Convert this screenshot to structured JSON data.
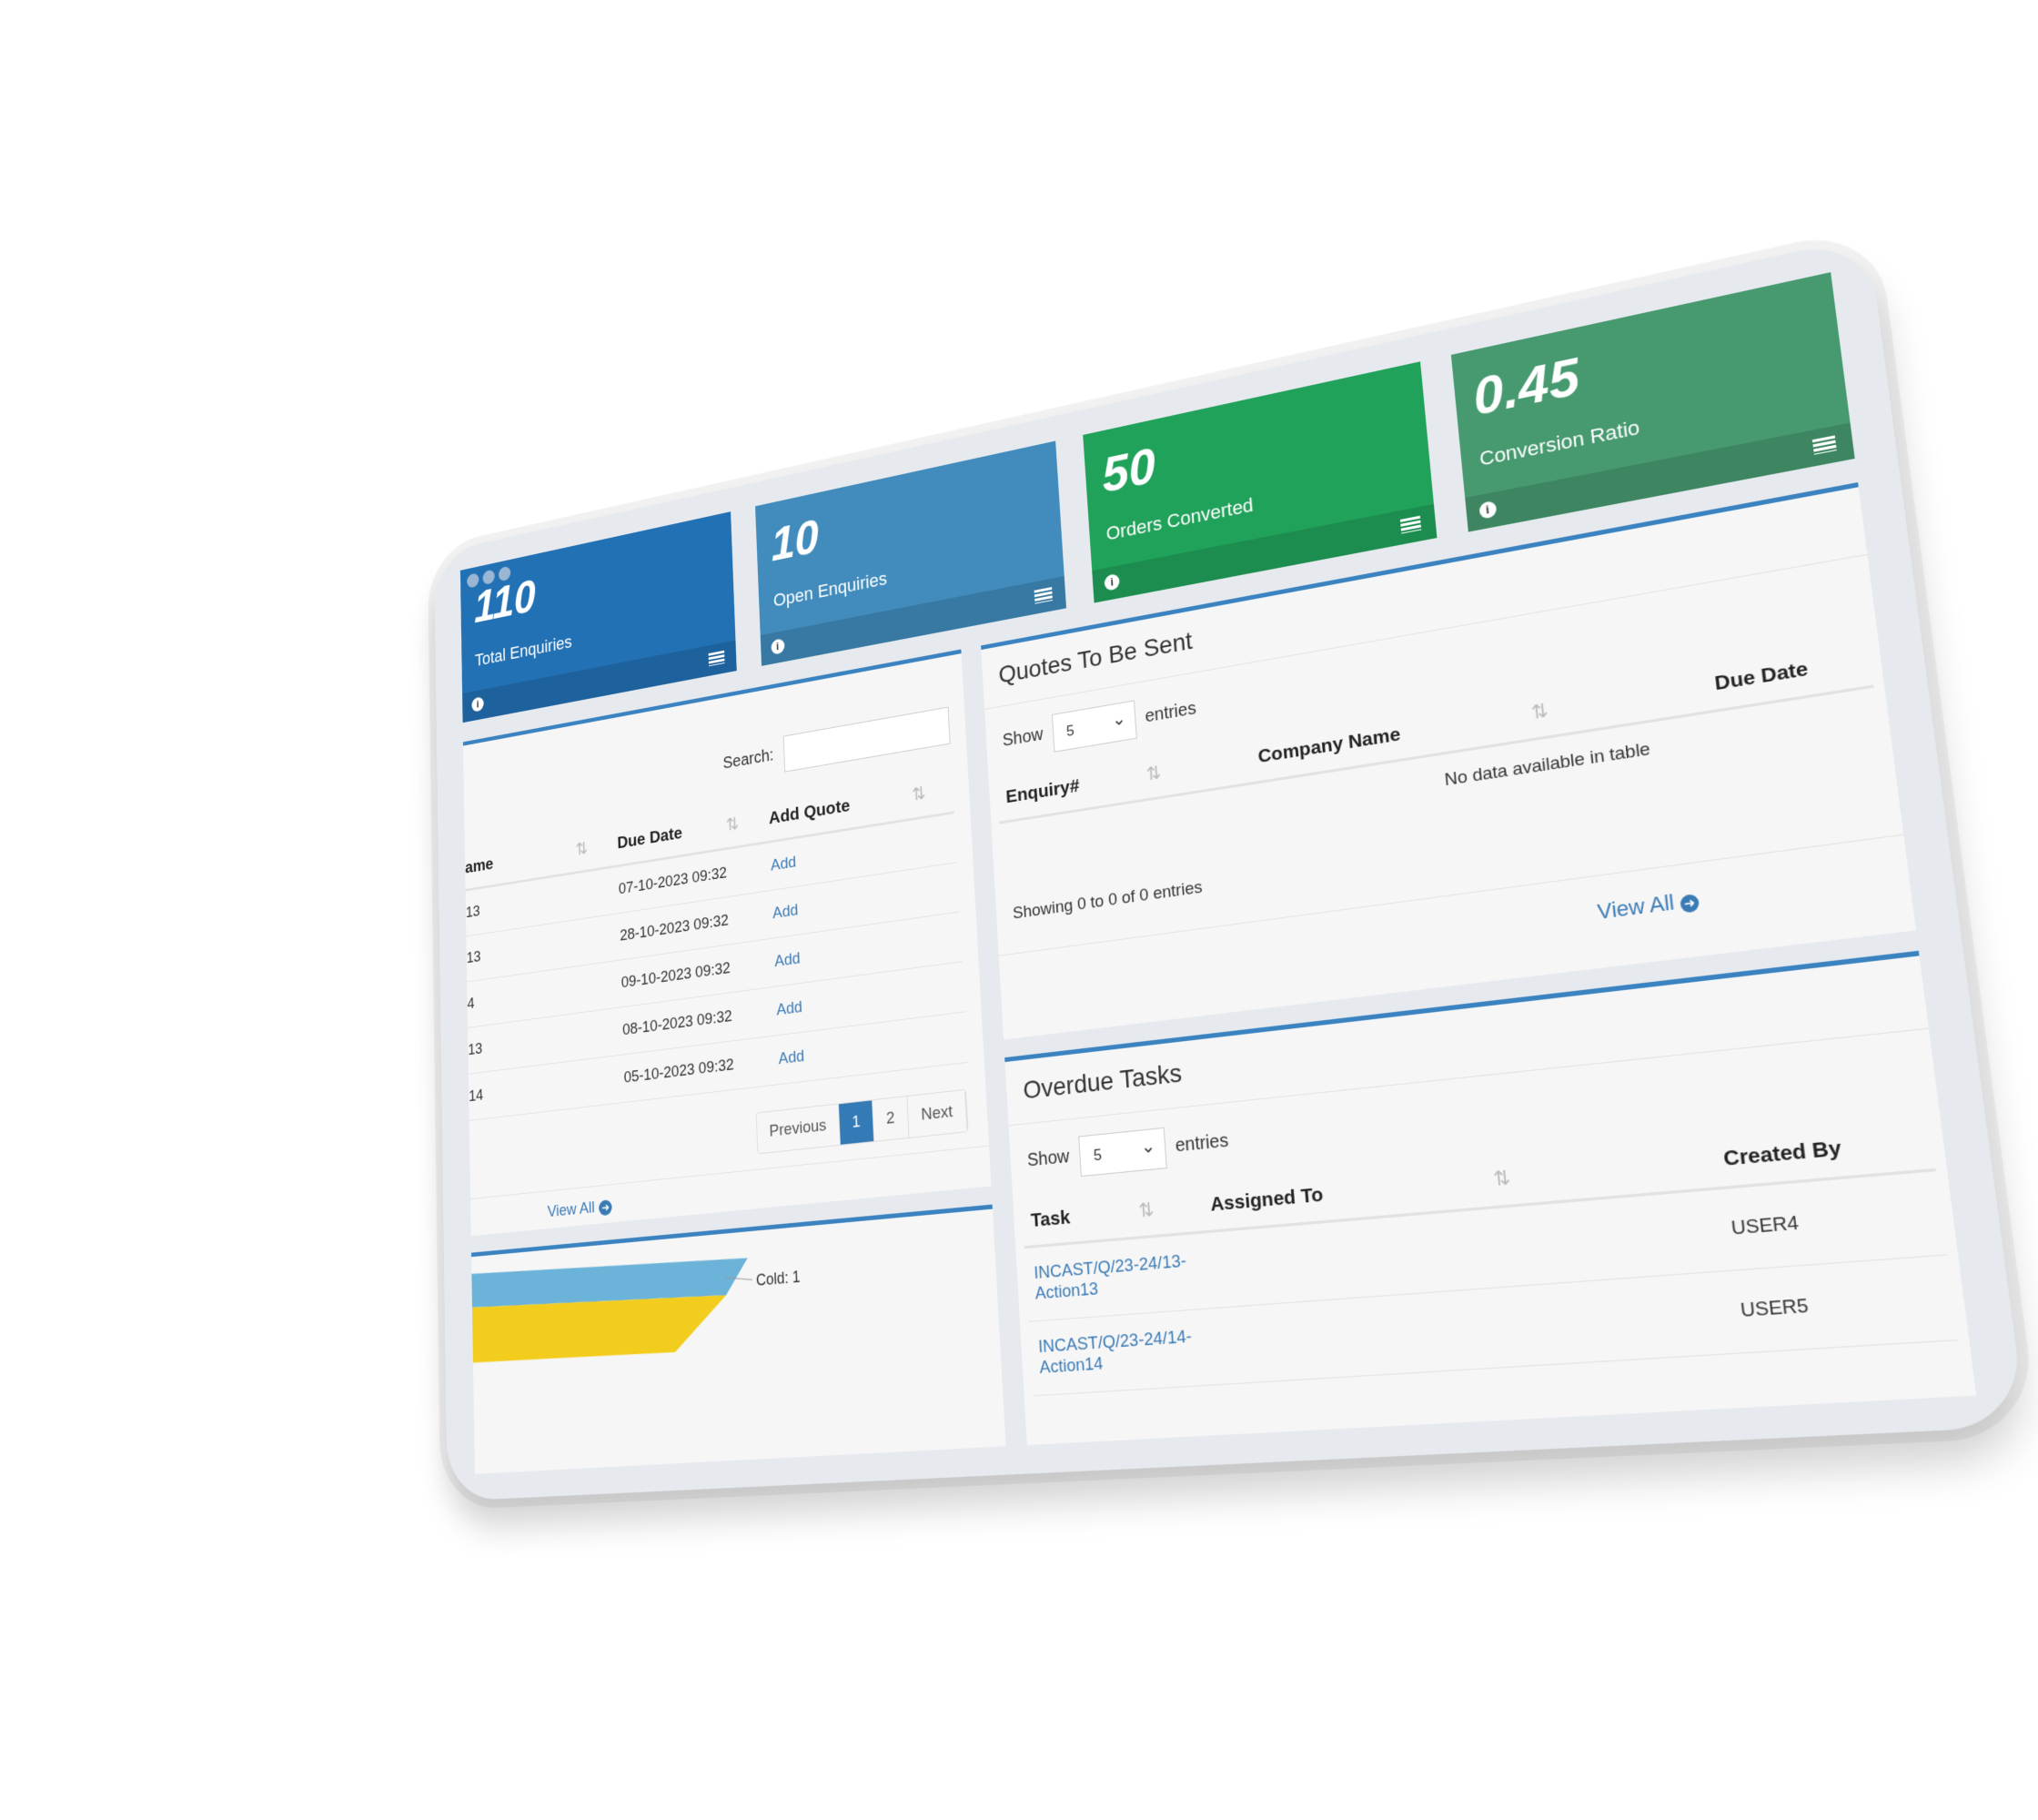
{
  "cards": [
    {
      "value": "110",
      "label": "Total Enquiries",
      "color": "#2371b5"
    },
    {
      "value": "10",
      "label": "Open Enquiries",
      "color": "#418cbc"
    },
    {
      "value": "50",
      "label": "Orders Converted",
      "color": "#21a25a"
    },
    {
      "value": "0.45",
      "label": "Conversion Ratio",
      "color": "#479a70"
    }
  ],
  "enquiries": {
    "search_label": "Search:",
    "columns": [
      "ame",
      "Due Date",
      "Add Quote"
    ],
    "rows": [
      {
        "name": "13",
        "due": "07-10-2023 09:32",
        "action": "Add"
      },
      {
        "name": "13",
        "due": "28-10-2023 09:32",
        "action": "Add"
      },
      {
        "name": "4",
        "due": "09-10-2023 09:32",
        "action": "Add"
      },
      {
        "name": "13",
        "due": "08-10-2023 09:32",
        "action": "Add"
      },
      {
        "name": "14",
        "due": "05-10-2023 09:32",
        "action": "Add"
      }
    ],
    "pager": {
      "previous": "Previous",
      "pages": [
        "1",
        "2"
      ],
      "current": "1",
      "next": "Next"
    },
    "view_all": "View All"
  },
  "funnel": {
    "label": "Cold: 1",
    "colors": [
      "#6bb3d9",
      "#f3cd1d"
    ]
  },
  "quotes": {
    "title": "Quotes To Be Sent",
    "show": "Show",
    "entries": "entries",
    "page_size": "5",
    "columns": [
      "Enquiry#",
      "Company Name",
      "Due Date"
    ],
    "empty": "No data available in table",
    "info": "Showing 0 to 0 of 0 entries",
    "view_all": "View All"
  },
  "overdue": {
    "title": "Overdue Tasks",
    "show": "Show",
    "entries": "entries",
    "page_size": "5",
    "columns": [
      "Task",
      "Assigned To",
      "Created By"
    ],
    "rows": [
      {
        "task": "INCAST/Q/23-24/13-Action13",
        "assigned": "",
        "created": "USER4"
      },
      {
        "task": "INCAST/Q/23-24/14-Action14",
        "assigned": "",
        "created": "USER5"
      }
    ]
  }
}
